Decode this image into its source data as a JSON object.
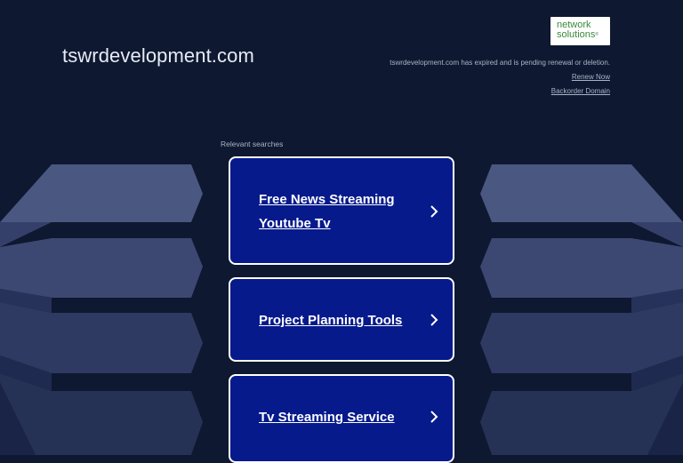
{
  "header": {
    "domain": "tswrdevelopment.com",
    "logo": {
      "line1": "network",
      "line2": "solutions",
      "mark": "®"
    },
    "notice": "tswrdevelopment.com has expired and is pending renewal or deletion.",
    "renew_label": "Renew Now",
    "backorder_label": "Backorder Domain"
  },
  "searches": {
    "heading": "Relevant searches",
    "items": [
      {
        "line1": "Free News Streaming",
        "line2": "Youtube Tv"
      },
      {
        "line1": "Project Planning Tools"
      },
      {
        "line1": "Tv Streaming Service"
      }
    ]
  },
  "icons": {
    "chevron": "chevron-right-icon"
  },
  "colors": {
    "background": "#0e1830",
    "card": "#061a8c",
    "card_border": "#ffffff",
    "logo_green": "#3a8a3a"
  }
}
